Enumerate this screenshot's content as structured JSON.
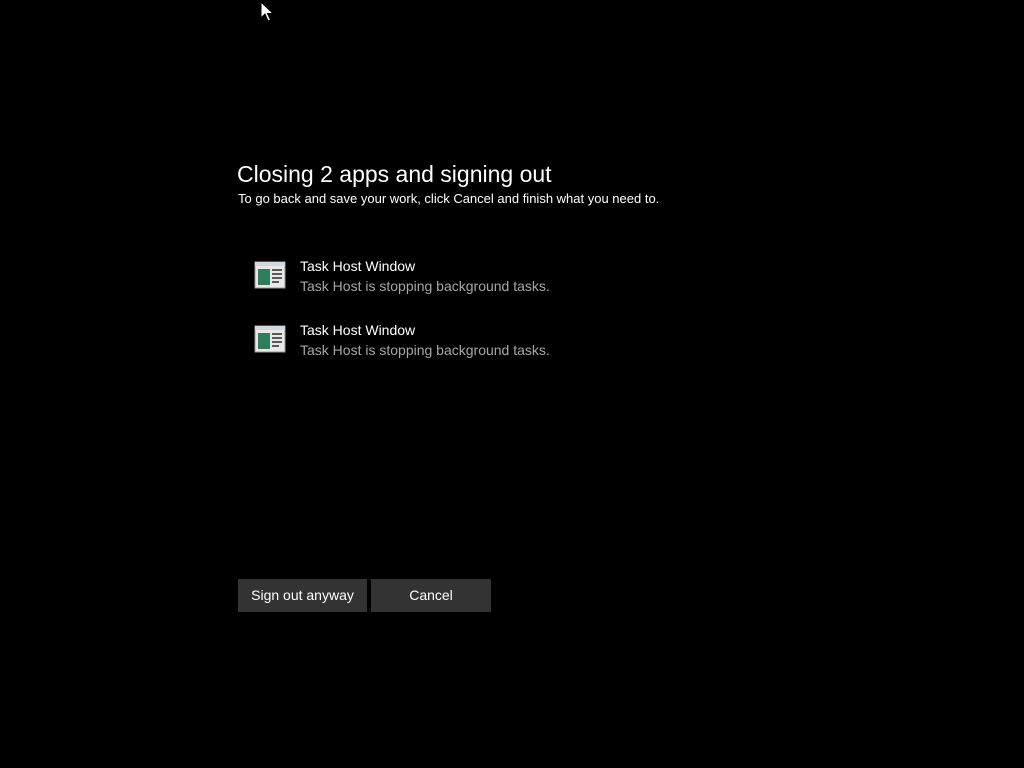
{
  "dialog": {
    "title": "Closing 2 apps and signing out",
    "subtitle": "To go back and save your work, click Cancel and finish what you need to."
  },
  "apps": [
    {
      "name": "Task Host Window",
      "status": "Task Host is stopping background tasks.",
      "icon": "task-host-window-icon"
    },
    {
      "name": "Task Host Window",
      "status": "Task Host is stopping background tasks.",
      "icon": "task-host-window-icon"
    }
  ],
  "buttons": {
    "sign_out_anyway": "Sign out anyway",
    "cancel": "Cancel"
  },
  "colors": {
    "background": "#000000",
    "button_background": "#333333",
    "primary_text": "#ffffff",
    "secondary_text": "#a6a6a6"
  }
}
